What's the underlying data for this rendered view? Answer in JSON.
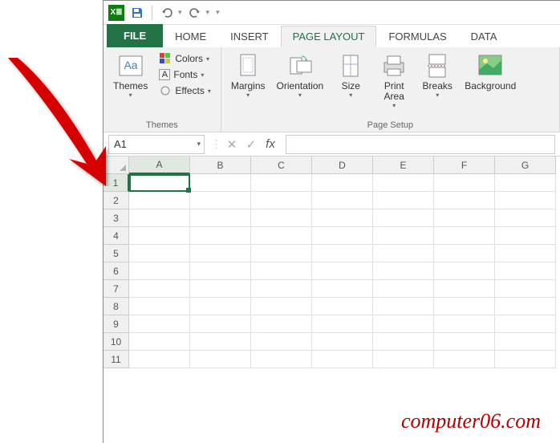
{
  "quick_access": {
    "save": "Save",
    "undo": "Undo",
    "redo": "Redo"
  },
  "tabs": {
    "file": "FILE",
    "home": "HOME",
    "insert": "INSERT",
    "page_layout": "PAGE LAYOUT",
    "formulas": "FORMULAS",
    "data": "DATA"
  },
  "ribbon": {
    "themes_group": {
      "label": "Themes",
      "themes": "Themes",
      "colors": "Colors",
      "fonts": "Fonts",
      "effects": "Effects"
    },
    "page_setup_group": {
      "label": "Page Setup",
      "margins": "Margins",
      "orientation": "Orientation",
      "size": "Size",
      "print_area": "Print\nArea",
      "breaks": "Breaks",
      "background": "Background"
    }
  },
  "name_box": {
    "value": "A1"
  },
  "formula_bar": {
    "fx": "fx"
  },
  "columns": [
    "A",
    "B",
    "C",
    "D",
    "E",
    "F",
    "G"
  ],
  "rows": [
    "1",
    "2",
    "3",
    "4",
    "5",
    "6",
    "7",
    "8",
    "9",
    "10",
    "11"
  ],
  "active_cell": "A1",
  "watermark": "computer06.com"
}
